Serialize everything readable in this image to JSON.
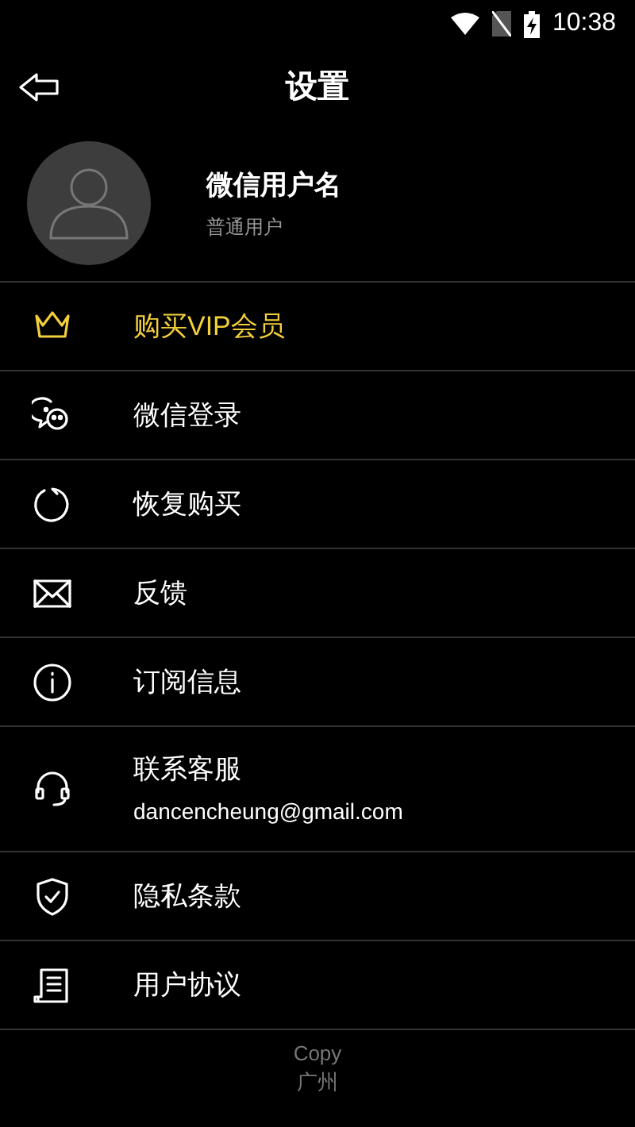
{
  "status_bar": {
    "time": "10:38"
  },
  "header": {
    "title": "设置"
  },
  "profile": {
    "name": "微信用户名",
    "level": "普通用户"
  },
  "menu": [
    {
      "label": "购买VIP会员",
      "highlighted": true
    },
    {
      "label": "微信登录",
      "highlighted": false
    },
    {
      "label": "恢复购买",
      "highlighted": false
    },
    {
      "label": "反馈",
      "highlighted": false
    },
    {
      "label": "订阅信息",
      "highlighted": false
    },
    {
      "label": "联系客服",
      "subtitle": "dancencheung@gmail.com",
      "highlighted": false
    },
    {
      "label": "隐私条款",
      "highlighted": false
    },
    {
      "label": "用户协议",
      "highlighted": false
    }
  ],
  "footer": [
    "Copy",
    "广州"
  ]
}
